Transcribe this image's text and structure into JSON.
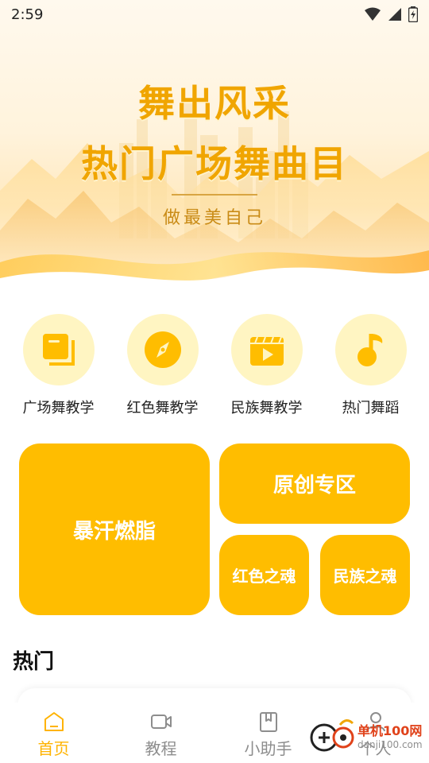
{
  "status_bar": {
    "time": "2:59"
  },
  "banner": {
    "title_line1": "舞出风采",
    "title_line2": "热门广场舞曲目",
    "subtitle": "做最美自己"
  },
  "categories": [
    {
      "label": "广场舞教学",
      "icon": "square-stack-icon"
    },
    {
      "label": "红色舞教学",
      "icon": "compass-icon"
    },
    {
      "label": "民族舞教学",
      "icon": "video-clapper-icon"
    },
    {
      "label": "热门舞蹈",
      "icon": "music-note-icon"
    }
  ],
  "tiles": {
    "big": "暴汗燃脂",
    "wide": "原创专区",
    "small1": "红色之魂",
    "small2": "民族之魂"
  },
  "hot_section": {
    "title": "热门"
  },
  "bottom_nav": [
    {
      "label": "首页",
      "icon": "home-icon",
      "active": true
    },
    {
      "label": "教程",
      "icon": "video-camera-icon",
      "active": false
    },
    {
      "label": "小助手",
      "icon": "bookmark-book-icon",
      "active": false
    },
    {
      "label": "个人",
      "icon": "person-icon",
      "active": false
    }
  ],
  "watermark": {
    "line1": "单机100网",
    "line2": "danji100.com"
  },
  "colors": {
    "accent": "#ffbd00",
    "icon_bg": "#fff5c2",
    "banner_text": "#f0a500",
    "nav_inactive": "#8d8d8d"
  }
}
